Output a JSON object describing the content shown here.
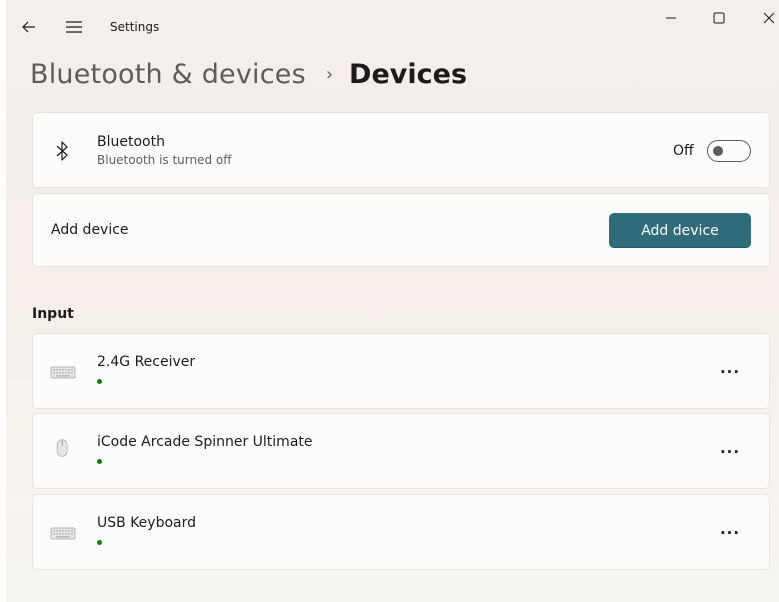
{
  "window": {
    "app_title": "Settings"
  },
  "breadcrumb": {
    "parent": "Bluetooth & devices",
    "separator": "›",
    "current": "Devices"
  },
  "bluetooth": {
    "title": "Bluetooth",
    "subtitle": "Bluetooth is turned off",
    "toggle_state_label": "Off",
    "toggle_on": false,
    "icon": "bluetooth-icon"
  },
  "add_device": {
    "label": "Add device",
    "button_label": "Add device",
    "button_color": "#2e6c7a"
  },
  "input_section": {
    "heading": "Input",
    "devices": [
      {
        "name": "2.4G Receiver",
        "icon": "keyboard-icon",
        "connected": true,
        "more_label": "···"
      },
      {
        "name": "iCode Arcade Spinner Ultimate",
        "icon": "mouse-icon",
        "connected": true,
        "more_label": "···"
      },
      {
        "name": "USB Keyboard",
        "icon": "keyboard-icon",
        "connected": true,
        "more_label": "···"
      }
    ]
  },
  "colors": {
    "status_connected": "#107c10",
    "accent": "#2e6c7a"
  }
}
